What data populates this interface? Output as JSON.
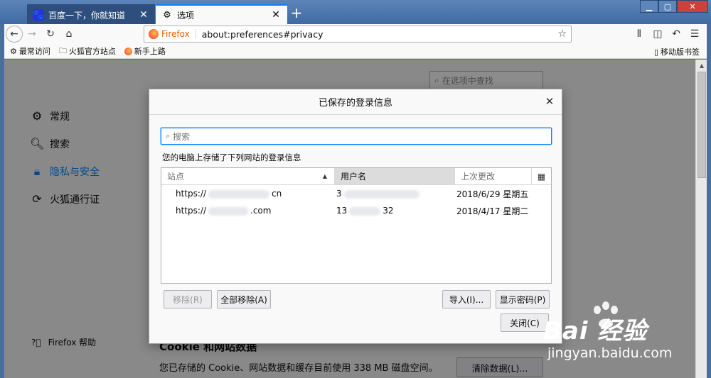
{
  "tabs": [
    {
      "label": "百度一下，你就知道",
      "icon": "baidu-icon",
      "active": false
    },
    {
      "label": "选项",
      "icon": "gear-icon",
      "active": true
    }
  ],
  "navbar": {
    "brand": "Firefox",
    "url": "about:preferences#privacy"
  },
  "bookmarks": {
    "items": [
      {
        "label": "最常访问",
        "icon": "gear-icon"
      },
      {
        "label": "火狐官方站点",
        "icon": "folder-icon"
      },
      {
        "label": "新手上路",
        "icon": "firefox-icon"
      }
    ],
    "mobile": "移动版书签"
  },
  "prefs": {
    "search_placeholder": "在选项中查找",
    "sidebar": [
      {
        "label": "常规",
        "icon": "gear-icon"
      },
      {
        "label": "搜索",
        "icon": "search-icon"
      },
      {
        "label": "隐私与安全",
        "icon": "lock-icon",
        "selected": true
      },
      {
        "label": "火狐通行证",
        "icon": "sync-icon"
      }
    ],
    "help": "Firefox 帮助",
    "cookie_title": "Cookie 和网站数据",
    "cookie_text": "您已存储的 Cookie、网站数据和缓存目前使用 338 MB 磁盘空间。",
    "clear_button": "清除数据(L)..."
  },
  "dialog": {
    "title": "已保存的登录信息",
    "search_placeholder": "搜索",
    "description": "您的电脑上存储了下列网站的登录信息",
    "columns": {
      "site": "站点",
      "username": "用户名",
      "last_changed": "上次更改"
    },
    "rows": [
      {
        "site_start": "https://",
        "site_end": "cn",
        "user_start": "3",
        "user_end": "",
        "date": "2018/6/29 星期五"
      },
      {
        "site_start": "https://",
        "site_end": ".com",
        "user_start": "13",
        "user_end": "32",
        "date": "2018/4/17 星期二"
      }
    ],
    "buttons": {
      "remove": "移除(R)",
      "remove_all": "全部移除(A)",
      "import": "导入(I)...",
      "show_passwords": "显示密码(P)",
      "close": "关闭(C)"
    }
  },
  "watermark": {
    "logo": "Bai  经验",
    "url": "jingyan.baidu.com"
  }
}
